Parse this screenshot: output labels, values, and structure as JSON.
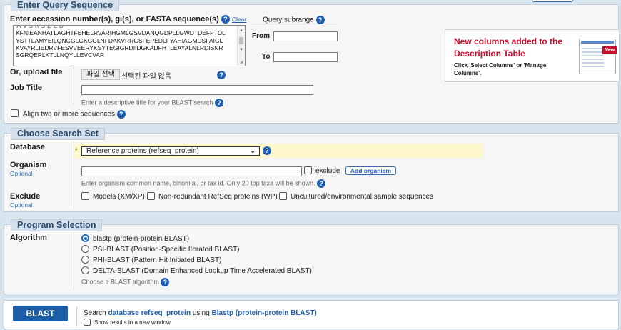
{
  "query": {
    "legend": "Enter Query Sequence",
    "accession_label": "Enter accession number(s), gi(s), or FASTA sequence(s)",
    "clear_link": "Clear",
    "sequence_lines": [
      "KFNIEANHATLAGHTFEHELRVARIHGMLGSVDANQGDPLLGWDTDEFPTDL",
      "YSTTLAMYEILQNGGLGKGGLNFDAKVRRGSFEPEDLFYAHIAGMDSFAIGL",
      "KVAYRLIEDRVFESVVEERYKSYTEGIGRDIIDGKADFHTLEAYALNLRDISNR",
      "SGRQERLKTLLNQYLLEVCVAR"
    ],
    "subrange_title": "Query subrange",
    "from_label": "From",
    "to_label": "To",
    "from_value": "",
    "to_value": "",
    "upload_label": "Or, upload file",
    "file_button": "파일 선택",
    "file_status": "선택된 파일 없음",
    "job_title_label": "Job Title",
    "job_title_value": "",
    "job_title_hint": "Enter a descriptive title for your BLAST search",
    "align_label": "Align two or more sequences"
  },
  "promo": {
    "title": "New columns added to the Description Table",
    "text": "Click 'Select Columns' or 'Manage Columns'.",
    "badge": "New"
  },
  "search_set": {
    "legend": "Choose Search Set",
    "database_label": "Database",
    "database_value": "Reference proteins (refseq_protein)",
    "organism_label": "Organism",
    "optional": "Optional",
    "organism_value": "",
    "exclude_check_label": "exclude",
    "add_organism": "Add organism",
    "organism_hint": "Enter organism common name, binomial, or tax id. Only 20 top taxa will be shown.",
    "exclude_label": "Exclude",
    "exclude_optional": "Optional",
    "exclude_options": [
      "Models (XM/XP)",
      "Non-redundant RefSeq proteins (WP)",
      "Uncultured/environmental sample sequences"
    ]
  },
  "program": {
    "legend": "Program Selection",
    "algorithm_label": "Algorithm",
    "options": [
      "blastp (protein-protein BLAST)",
      "PSI-BLAST (Position-Specific Iterated BLAST)",
      "PHI-BLAST (Pattern Hit Initiated BLAST)",
      "DELTA-BLAST (Domain Enhanced Lookup Time Accelerated BLAST)"
    ],
    "selected": "blastp (protein-protein BLAST)",
    "hint": "Choose a BLAST algorithm"
  },
  "submit": {
    "button": "BLAST",
    "search_prefix": "Search",
    "database_text": "database refseq_protein",
    "using": "using",
    "program_text": "Blastp (protein-protein BLAST)",
    "new_window_label": "Show results in a new window"
  },
  "colors": {
    "accent": "#1f5fb0",
    "promo_red": "#c8102e",
    "db_highlight": "#fff8cc"
  }
}
